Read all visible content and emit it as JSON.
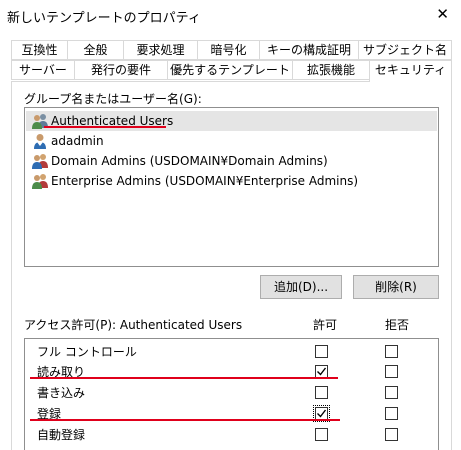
{
  "window": {
    "title": "新しいテンプレートのプロパティ",
    "close_glyph": "✕"
  },
  "tabs_row1": [
    "互換性",
    "全般",
    "要求処理",
    "暗号化",
    "キーの構成証明",
    "サブジェクト名"
  ],
  "tabs_row2": [
    "サーバー",
    "発行の要件",
    "優先するテンプレート",
    "拡張機能",
    "セキュリティ"
  ],
  "active_tab": "セキュリティ",
  "groups": {
    "label": "グループ名またはユーザー名(G):",
    "items": [
      {
        "name": "Authenticated Users",
        "icon": "group-icon",
        "selected": true
      },
      {
        "name": "adadmin",
        "icon": "user-icon",
        "selected": false
      },
      {
        "name": "Domain Admins (USDOMAIN¥Domain Admins)",
        "icon": "group-icon",
        "selected": false
      },
      {
        "name": "Enterprise Admins (USDOMAIN¥Enterprise Admins)",
        "icon": "group-icon",
        "selected": false
      }
    ]
  },
  "buttons": {
    "add": "追加(D)...",
    "remove": "削除(R)"
  },
  "permissions": {
    "label": "アクセス許可(P): Authenticated Users",
    "allow_header": "許可",
    "deny_header": "拒否",
    "rows": [
      {
        "name": "フル コントロール",
        "allow": false,
        "deny": false
      },
      {
        "name": "読み取り",
        "allow": true,
        "deny": false
      },
      {
        "name": "書き込み",
        "allow": false,
        "deny": false
      },
      {
        "name": "登録",
        "allow": true,
        "deny": false
      },
      {
        "name": "自動登録",
        "allow": false,
        "deny": false
      }
    ]
  },
  "colors": {
    "annotation_red": "#e0001b",
    "selection_bg": "#e5e5e5"
  }
}
